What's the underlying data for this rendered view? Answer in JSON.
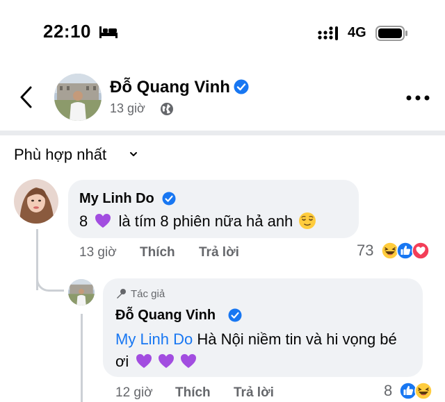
{
  "status_bar": {
    "time": "22:10",
    "network": "4G"
  },
  "post": {
    "author_name": "Đỗ Quang Vinh",
    "time": "13 giờ"
  },
  "sort": {
    "label": "Phù hợp nhất"
  },
  "comments": [
    {
      "name": "My Linh Do",
      "text_prefix": "8",
      "text_suffix": "là tím 8 phiên nữa hả anh",
      "time": "13 giờ",
      "like_label": "Thích",
      "reply_label": "Trả lời",
      "reaction_count": "73",
      "reactions": [
        "laugh-icon",
        "like-icon",
        "love-icon"
      ]
    }
  ],
  "reply": {
    "badge": "Tác giả",
    "name": "Đỗ Quang Vinh",
    "mention": "My Linh Do",
    "text": "Hà Nội niềm tin và hi vọng bé ơi",
    "time": "12 giờ",
    "like_label": "Thích",
    "reply_label": "Trả lời",
    "reaction_count": "8",
    "reactions": [
      "like-icon",
      "laugh-icon"
    ]
  },
  "colors": {
    "accent": "#1877f2",
    "bubble": "#f0f2f5",
    "muted_text": "#65676b",
    "heart_purple": "#a24de0"
  }
}
